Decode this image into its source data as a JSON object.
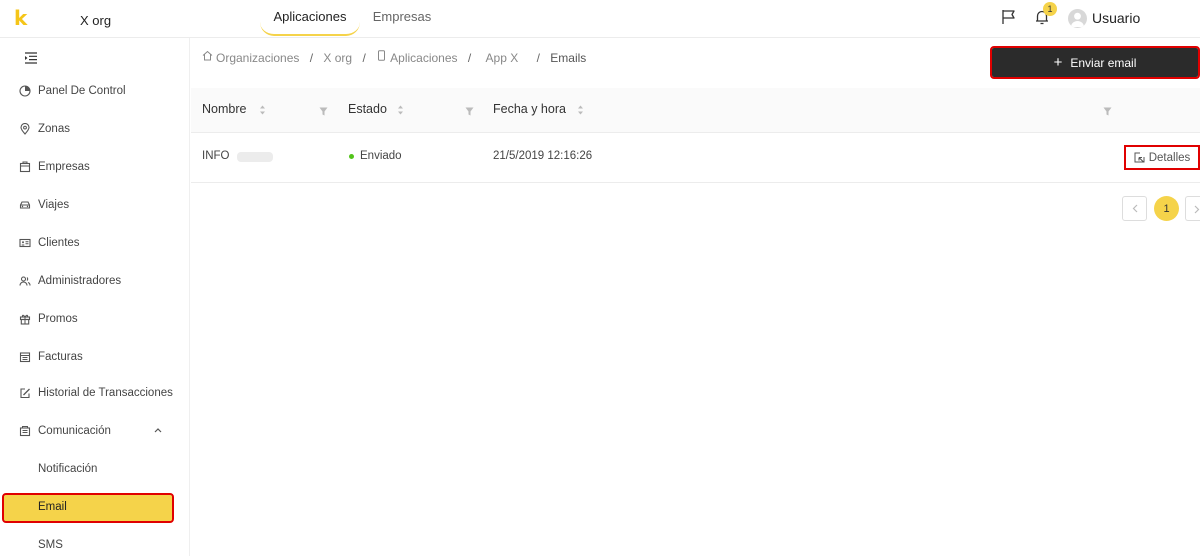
{
  "topbar": {
    "logo": "k",
    "org_name": "X org",
    "tabs": [
      {
        "label": "Aplicaciones",
        "active": true
      },
      {
        "label": "Empresas",
        "active": false
      }
    ],
    "icons": [
      "flag-icon",
      "bell-icon"
    ],
    "notification_count": "1",
    "user_name": "Usuario"
  },
  "sidebar": {
    "collapse_icon": "menu-fold-icon",
    "items": [
      {
        "label": "Panel De Control",
        "icon": "dashboard-icon"
      },
      {
        "label": "Zonas",
        "icon": "location-icon"
      },
      {
        "label": "Empresas",
        "icon": "building-icon"
      },
      {
        "label": "Viajes",
        "icon": "car-icon"
      },
      {
        "label": "Clientes",
        "icon": "id-card-icon"
      },
      {
        "label": "Administradores",
        "icon": "users-icon"
      },
      {
        "label": "Promos",
        "icon": "gift-icon"
      },
      {
        "label": "Facturas",
        "icon": "invoice-icon"
      },
      {
        "label": "Historial de Transacciones",
        "icon": "edit-icon"
      },
      {
        "label": "Comunicación",
        "icon": "communication-icon",
        "expanded": true
      }
    ],
    "sub_items": [
      {
        "label": "Notificación",
        "active": false
      },
      {
        "label": "Email",
        "active": true
      },
      {
        "label": "SMS",
        "active": false
      }
    ]
  },
  "breadcrumb": {
    "items": [
      "Organizaciones",
      "X org",
      "Aplicaciones",
      "App X",
      "Emails"
    ],
    "separator": "/"
  },
  "actions": {
    "send_email_plus": "+",
    "send_email_label": "Enviar email"
  },
  "table": {
    "columns": [
      "Nombre",
      "Estado",
      "Fecha y hora"
    ],
    "rows": [
      {
        "name": "INFO",
        "status": "Enviado",
        "datetime": "21/5/2019 12:16:26",
        "action": "Detalles"
      }
    ]
  },
  "pagination": {
    "current_page": "1"
  },
  "colors": {
    "accent": "#f5d34a",
    "dark_button": "#2b2b2b",
    "status_sent": "#52c41a",
    "highlight": "#e00000"
  }
}
